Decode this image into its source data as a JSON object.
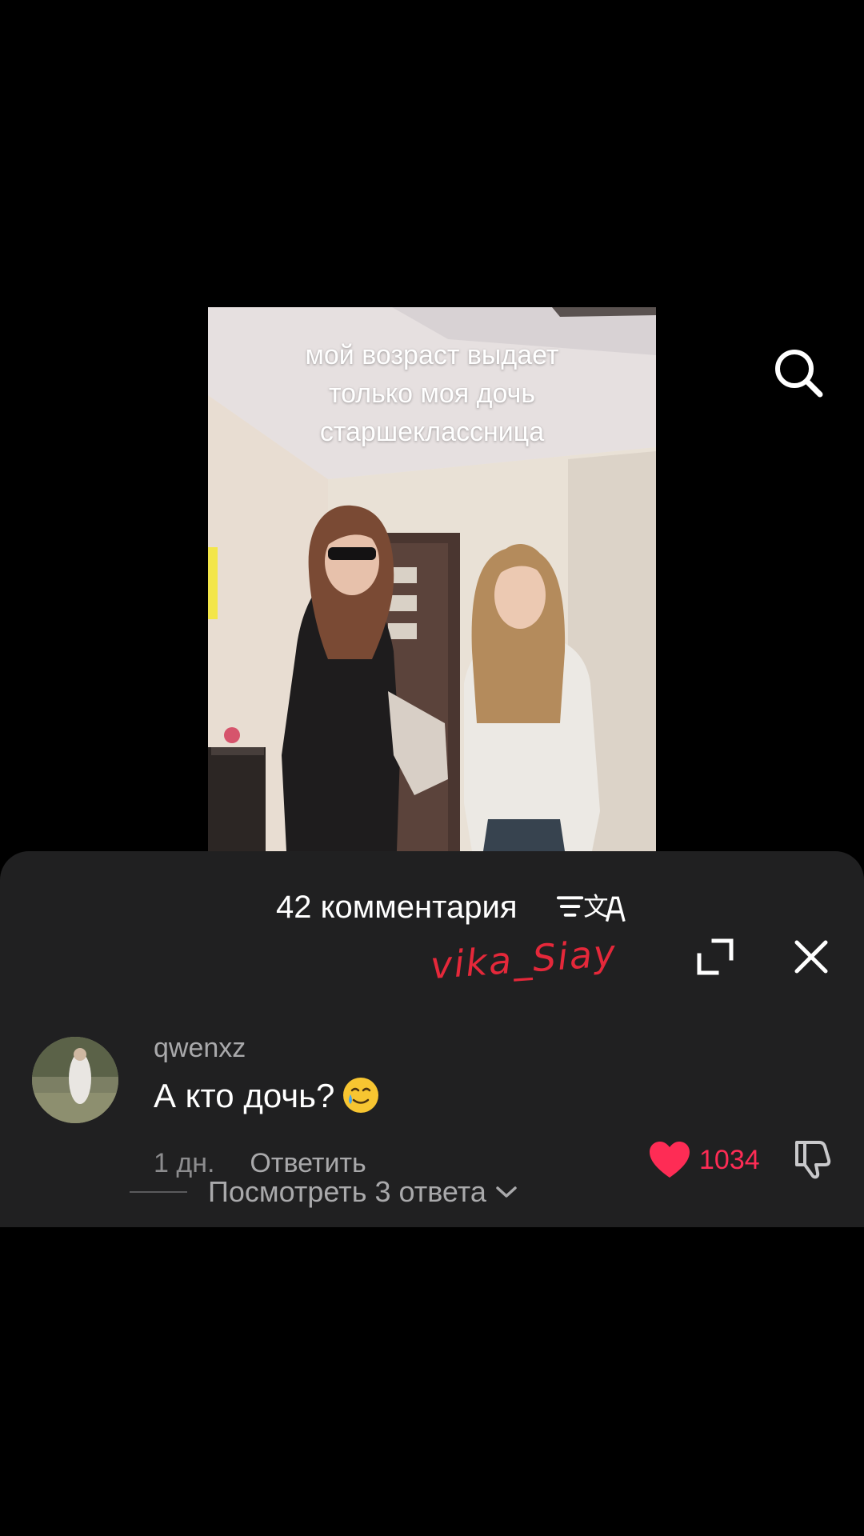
{
  "video": {
    "caption_lines": [
      "мой возраст выдает",
      "только моя дочь",
      "старшеклассница"
    ]
  },
  "icons": {
    "search": "search-icon",
    "translate": "translate-icon",
    "expand": "expand-icon",
    "close": "close-icon",
    "like": "heart-icon",
    "dislike": "thumbs-down-icon",
    "chevron": "chevron-down-icon",
    "emoji": "smiling-face-with-tear-emoji"
  },
  "comments_panel": {
    "title": "42 комментария",
    "watermark": "vika_Siay",
    "comment": {
      "username": "qwenxz",
      "text": "А кто дочь?",
      "date": "1 дн.",
      "reply_label": "Ответить",
      "like_count": "1034"
    },
    "view_replies_label": "Посмотреть 3 ответа"
  },
  "colors": {
    "background": "#000000",
    "sheet": "#202021",
    "like_accent": "#fe2c55",
    "watermark": "#e5283a"
  }
}
